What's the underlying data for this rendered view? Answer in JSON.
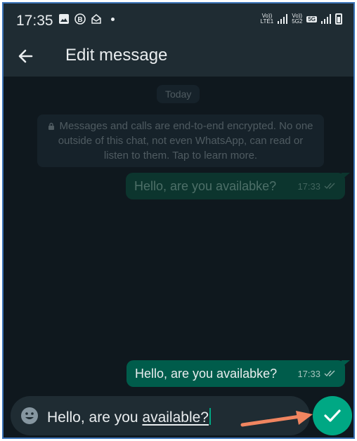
{
  "status_bar": {
    "time": "17:35",
    "network1": {
      "top": "Vo))",
      "bottom": "LTE1"
    },
    "network2": {
      "top": "Vo))",
      "bottom": "5G2"
    },
    "badge": "5G"
  },
  "app_bar": {
    "title": "Edit message"
  },
  "chat": {
    "date_label": "Today",
    "encryption_notice": "Messages and calls are end-to-end encrypted. No one outside of this chat, not even WhatsApp, can read or listen to them. Tap to learn more.",
    "messages": [
      {
        "text": "Hello, are you availabke?",
        "time": "17:33",
        "state": "dimmed"
      },
      {
        "text": "Hello, are you availabke?",
        "time": "17:33",
        "state": "editing"
      }
    ]
  },
  "composer": {
    "text_plain": "Hello, are you ",
    "text_corrected": "available?"
  },
  "colors": {
    "accent": "#00a884",
    "bubble_out": "#005c4b",
    "background": "#0b141a",
    "bar": "#1f2c33",
    "annotation_arrow": "#f08560"
  },
  "icons": {
    "back": "arrow-left-icon",
    "emoji": "emoji-icon",
    "send": "checkmark-icon",
    "read_receipt": "double-check-icon"
  }
}
